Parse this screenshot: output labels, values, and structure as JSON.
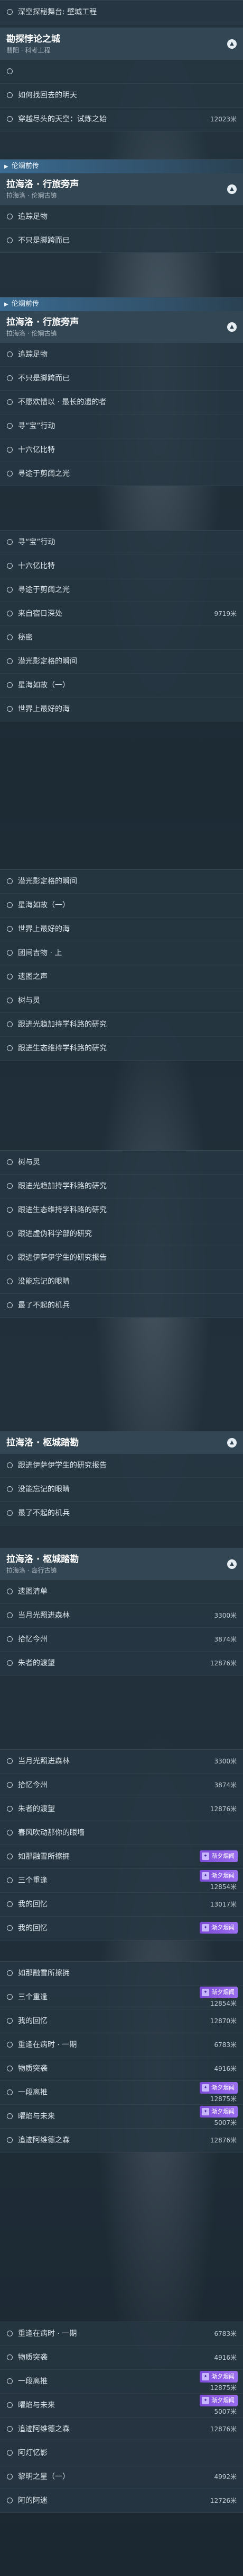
{
  "colors": {
    "accent": "#3c6e96",
    "badge": "#8b5ce6"
  },
  "seg1": {
    "rows": [
      {
        "label": "深空探秘舞台: 壁城工程",
        "dist": ""
      },
      {
        "label": "",
        "dist": ""
      },
      {
        "label": "如何找回去的明天",
        "dist": ""
      },
      {
        "label": "穿越尽头的天空：试炼之始",
        "dist": "12023米"
      }
    ]
  },
  "seg1_head": {
    "title": "勘探悖论之城",
    "sub": "翡阳 · 科考工程"
  },
  "seg2": {
    "tag": "伦斓前传",
    "head": {
      "title": "拉海洛 · 行旅旁声",
      "sub": "拉海洛 · 伦斓古镇"
    },
    "rows": [
      {
        "label": "追踪足物"
      },
      {
        "label": "不只是脚跨而已"
      }
    ]
  },
  "seg3": {
    "tag": "伦斓前传",
    "head": {
      "title": "拉海洛 · 行旅旁声",
      "sub": "拉海洛 · 伦斓古镇"
    },
    "rows": [
      {
        "label": "追踪足物"
      },
      {
        "label": "不只是脚跨而已"
      },
      {
        "label": "不愿欢惜以 · 最长的遗的者"
      },
      {
        "label": "寻“宝”行动"
      },
      {
        "label": "十六亿比特"
      },
      {
        "label": "寻途于剪阔之光"
      }
    ]
  },
  "seg4": {
    "rows": [
      {
        "label": "寻“宝”行动",
        "dist": ""
      },
      {
        "label": "十六亿比特",
        "dist": ""
      },
      {
        "label": "寻途于剪阔之光",
        "dist": ""
      },
      {
        "label": "来自宿日深处",
        "dist": "9719米"
      },
      {
        "label": "秘密",
        "dist": ""
      },
      {
        "label": "潜光影定格的瞬间",
        "dist": ""
      },
      {
        "label": "星海如故（一）",
        "dist": ""
      },
      {
        "label": "世界上最好的海",
        "dist": ""
      }
    ]
  },
  "seg5": {
    "rows": [
      {
        "label": "潜光影定格的瞬间"
      },
      {
        "label": "星海如故（一）"
      },
      {
        "label": "世界上最好的海"
      },
      {
        "label": "团间吉物 · 上"
      },
      {
        "label": "遗图之声"
      },
      {
        "label": "树与灵"
      },
      {
        "label": "跟进光趋加持学科路的研究"
      },
      {
        "label": "跟进生态维持学科路的研究"
      }
    ]
  },
  "seg6": {
    "rows": [
      {
        "label": "树与灵"
      },
      {
        "label": "跟进光趋加持学科路的研究"
      },
      {
        "label": "跟进生态维持学科路的研究"
      },
      {
        "label": "跟进虚伪科学部的研究"
      },
      {
        "label": "跟进伊萨伊学生的研究报告"
      },
      {
        "label": "没能忘记的眼睛"
      },
      {
        "label": "最了不起的机兵"
      }
    ]
  },
  "seg7": {
    "head": {
      "title": "拉海洛 · 枢城踏勘",
      "sub": ""
    },
    "rows": [
      {
        "label": "跟进伊萨伊学生的研究报告"
      },
      {
        "label": "没能忘记的眼睛"
      },
      {
        "label": "最了不起的机兵"
      }
    ]
  },
  "seg8": {
    "head": {
      "title": "拉海洛 · 枢城踏勘",
      "sub": "拉海洛 · 岛行古镇"
    },
    "rows": [
      {
        "label": "遗图清单",
        "dist": ""
      },
      {
        "label": "当月光照进森林",
        "dist": "3300米"
      },
      {
        "label": "拾忆今州",
        "dist": "3874米"
      },
      {
        "label": "朱者的渡望",
        "dist": "12876米"
      }
    ]
  },
  "seg9": {
    "badge": "渐夕烟闻",
    "rows": [
      {
        "label": "当月光照进森林",
        "dist": "3300米",
        "badge": false
      },
      {
        "label": "拾忆今州",
        "dist": "3874米",
        "badge": false
      },
      {
        "label": "朱者的渡望",
        "dist": "12876米",
        "badge": false
      },
      {
        "label": "春风吹动那你的眼墙",
        "dist": "",
        "badge": false
      },
      {
        "label": "如那融雪所擦拥",
        "dist": "",
        "badge": true
      },
      {
        "label": "三个重逢",
        "dist": "12854米",
        "badge": true
      },
      {
        "label": "我的回忆",
        "dist": "13017米",
        "badge": false
      },
      {
        "label": "我的回忆",
        "dist": "",
        "badge": true
      }
    ]
  },
  "seg10": {
    "badge": "渐夕烟闻",
    "rows": [
      {
        "label": "如那融雪所擦拥",
        "dist": "",
        "badge": false
      },
      {
        "label": "三个重逢",
        "dist": "12854米",
        "badge": true
      },
      {
        "label": "我的回忆",
        "dist": "12870米",
        "badge": false
      },
      {
        "label": "重逢在病时 · 一期",
        "dist": "6783米",
        "badge": false
      },
      {
        "label": "物质突袭",
        "dist": "4916米",
        "badge": false
      },
      {
        "label": "一段离推",
        "dist": "12875米",
        "badge": true
      },
      {
        "label": "曜焰与未来",
        "dist": "5007米",
        "badge": true
      },
      {
        "label": "追迹阿维德之森",
        "dist": "12876米",
        "badge": false
      }
    ]
  },
  "seg11": {
    "badge": "渐夕烟闻",
    "rows": [
      {
        "label": "重逢在病时 · 一期",
        "dist": "6783米",
        "badge": false
      },
      {
        "label": "物质突袭",
        "dist": "4916米",
        "badge": false
      },
      {
        "label": "一段离推",
        "dist": "12875米",
        "badge": true
      },
      {
        "label": "曜焰与未来",
        "dist": "5007米",
        "badge": true
      },
      {
        "label": "追迹阿维德之森",
        "dist": "12876米",
        "badge": false
      },
      {
        "label": "阿灯忆影",
        "dist": "",
        "badge": false
      },
      {
        "label": "黎明之星（一）",
        "dist": "4992米",
        "badge": false
      },
      {
        "label": "阿的阿迷",
        "dist": "12726米",
        "badge": false
      }
    ]
  }
}
